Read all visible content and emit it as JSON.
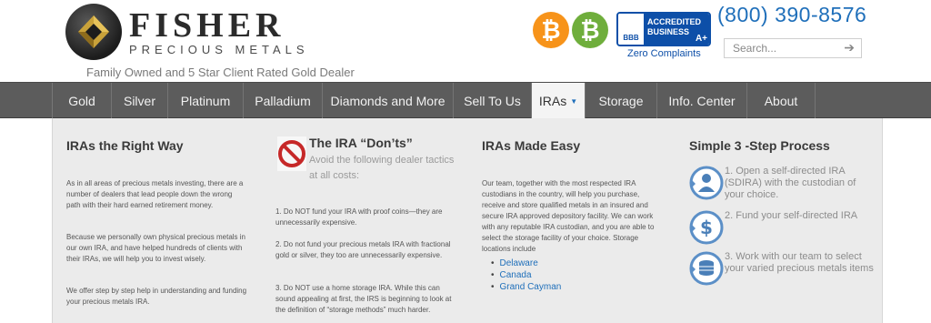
{
  "header": {
    "logo_name": "FISHER",
    "logo_sub": "PRECIOUS METALS",
    "tagline": "Family Owned and 5 Star Client Rated Gold Dealer",
    "bbb_line1": "ACCREDITED",
    "bbb_line2": "BUSINESS",
    "bbb_grade": "A+",
    "bbb_mark": "BBB",
    "zero_complaints": "Zero Complaints",
    "phone": "(800) 390-8576",
    "search_placeholder": "Search..."
  },
  "nav": {
    "items": [
      {
        "label": "Gold"
      },
      {
        "label": "Silver"
      },
      {
        "label": "Platinum"
      },
      {
        "label": "Palladium"
      },
      {
        "label": "Diamonds and More"
      },
      {
        "label": "Sell To Us"
      },
      {
        "label": "IRAs"
      },
      {
        "label": "Storage"
      },
      {
        "label": "Info. Center"
      },
      {
        "label": "About"
      }
    ],
    "active": "IRAs"
  },
  "panel": {
    "col1": {
      "title": "IRAs the Right Way",
      "p1": "As in all areas of precious metals investing, there are a number of dealers that lead people down the wrong path with their hard earned retirement money.",
      "p2": "Because we personally own physical precious metals in our own IRA, and have helped hundreds of clients with their IRAs, we will help you to invest wisely.",
      "p3": "We offer step by step help in understanding and funding your precious metals IRA."
    },
    "col2": {
      "title": "The IRA “Don’ts”",
      "lead": "Avoid the following dealer tactics at all costs:",
      "p1": "1. Do NOT fund your IRA with proof coins—they are unnecessarily expensive.",
      "p2": "2. Do not fund your precious metals IRA with fractional gold or silver, they too are unnecessarily expensive.",
      "p3": "3. Do NOT use a home storage IRA. While this can sound appealing at first, the IRS is beginning to look at the definition of “storage methods” much harder."
    },
    "col3": {
      "title": "IRAs Made Easy",
      "p1": "Our team, together with the most respected IRA custodians in the country, will help you purchase, receive and store qualified metals in an insured and secure IRA approved depository facility.   We can work with any reputable IRA custodian, and you are able to select the storage facility of your choice. Storage locations include",
      "locations": [
        "Delaware",
        "Canada",
        "Grand Cayman"
      ]
    },
    "col4": {
      "title": "Simple 3 -Step Process",
      "steps": [
        {
          "text": "1. Open a self-directed IRA (SDIRA) with the custodian of your choice."
        },
        {
          "text": "2. Fund your self-directed IRA"
        },
        {
          "text": "3. Work with our team to select your varied precious metals items"
        }
      ]
    }
  },
  "colors": {
    "nav_bg": "#5c5c5c",
    "link_blue": "#1f6fba",
    "bitcoin_orange": "#f7931a",
    "bitcoin_green": "#6fae3c",
    "bbb_blue": "#0d4fa8"
  },
  "icons": {
    "bitcoin_1": "bitcoin-icon",
    "bitcoin_2": "bitcoin-icon",
    "search": "arrow-right-icon",
    "dont": "no-sign-icon",
    "step1": "person-icon",
    "step2": "dollar-icon",
    "step3": "coin-stack-icon"
  }
}
